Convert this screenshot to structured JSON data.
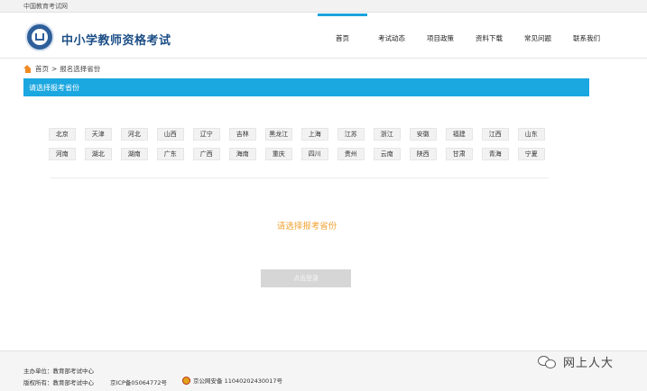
{
  "topbar": {
    "site_name": "中国教育考试网"
  },
  "header": {
    "brand": "中小学教师资格考试",
    "nav": [
      {
        "label": "首页",
        "active": true
      },
      {
        "label": "考试动态",
        "active": false
      },
      {
        "label": "项目政策",
        "active": false
      },
      {
        "label": "资料下载",
        "active": false
      },
      {
        "label": "常见问题",
        "active": false
      },
      {
        "label": "联系我们",
        "active": false
      }
    ]
  },
  "breadcrumb": {
    "home": "首页",
    "separator": ">",
    "current": "报名选择省份"
  },
  "section": {
    "title": "请选择报考省份"
  },
  "provinces": {
    "row1": [
      "北京",
      "天津",
      "河北",
      "山西",
      "辽宁",
      "吉林",
      "黑龙江",
      "上海",
      "江苏",
      "浙江",
      "安徽",
      "福建",
      "江西",
      "山东"
    ],
    "row2": [
      "河南",
      "湖北",
      "湖南",
      "广东",
      "广西",
      "海南",
      "重庆",
      "四川",
      "贵州",
      "云南",
      "陕西",
      "甘肃",
      "青海",
      "宁夏"
    ]
  },
  "prompt": "请选择报考省份",
  "login_button": "点击登录",
  "footer": {
    "sponsor": "主办单位：教育部考试中心",
    "copyright": "版权所有：教育部考试中心",
    "icp": "京ICP备05064772号",
    "police": "京公网安备 11040202430017号"
  },
  "watermark": {
    "text": "网上人大"
  },
  "colors": {
    "accent": "#1ba7e0",
    "brand": "#1c4e86",
    "prompt": "#f0a232",
    "home_icon": "#f08a24"
  }
}
